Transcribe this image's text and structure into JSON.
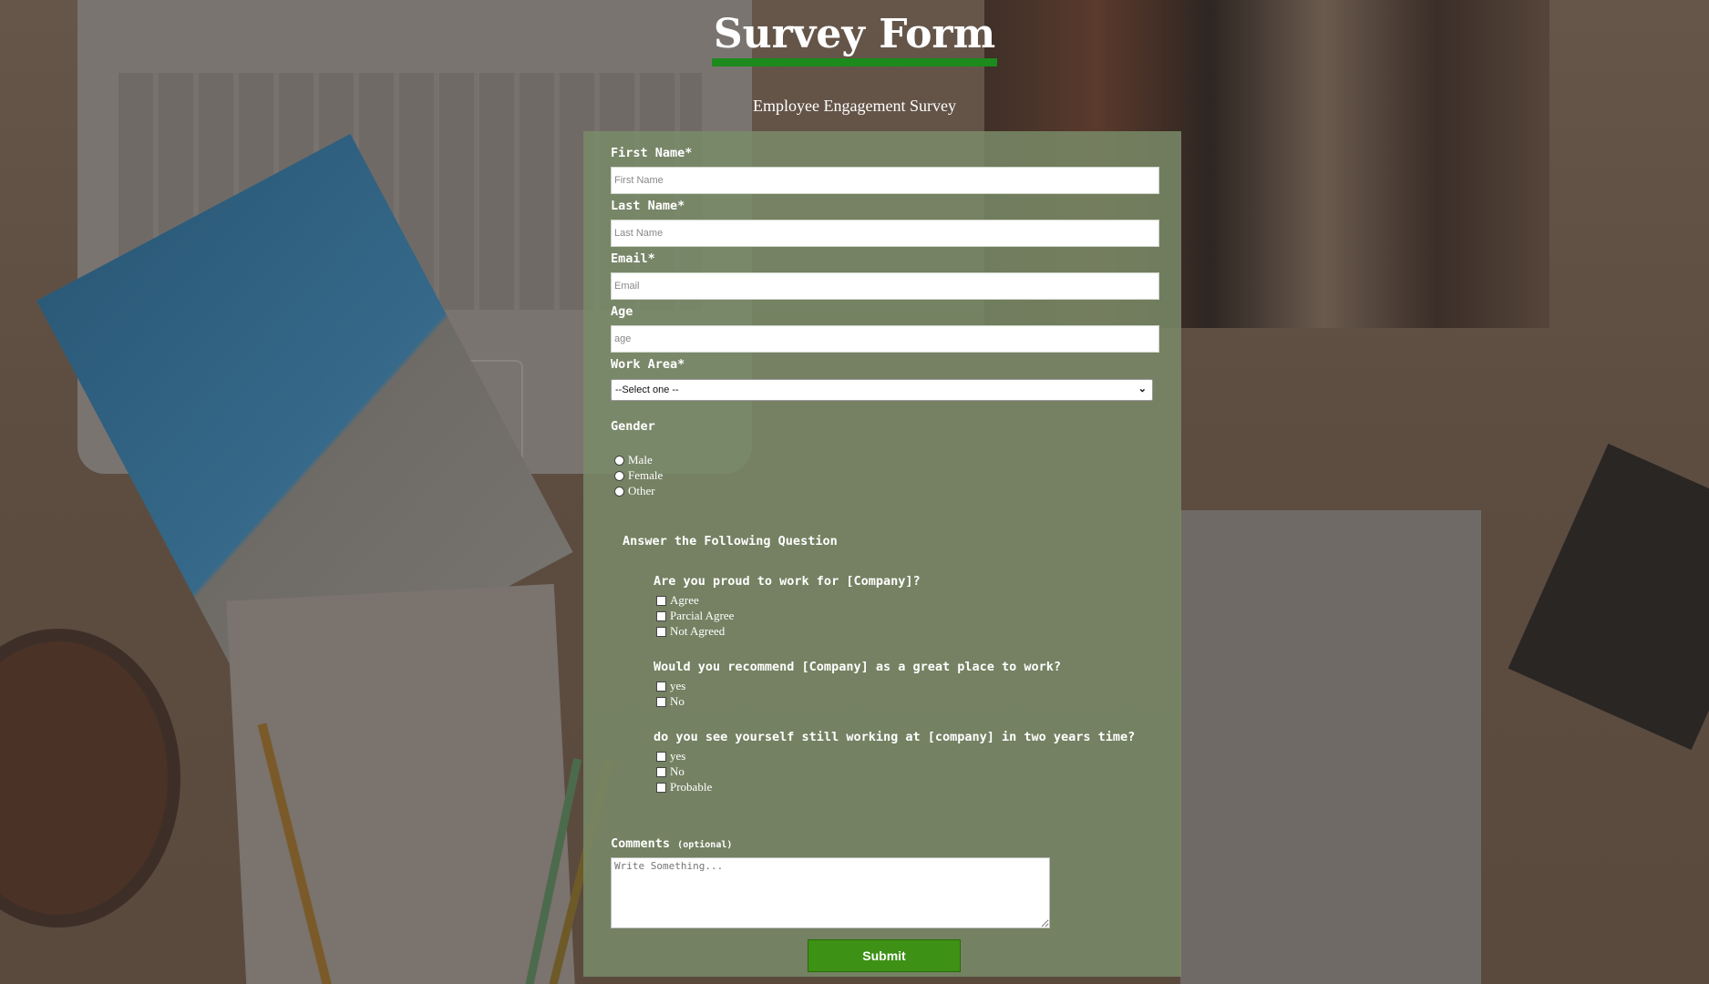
{
  "header": {
    "title": "Survey Form",
    "subtitle": "Employee Engagement Survey"
  },
  "form": {
    "first_name": {
      "label": "First Name*",
      "placeholder": "First Name"
    },
    "last_name": {
      "label": "Last Name*",
      "placeholder": "Last Name"
    },
    "email": {
      "label": "Email*",
      "placeholder": "Email"
    },
    "age": {
      "label": "Age",
      "placeholder": "age"
    },
    "work_area": {
      "label": "Work Area*",
      "selected": "--Select one --"
    },
    "gender": {
      "label": "Gender",
      "options": [
        "Male",
        "Female",
        "Other"
      ]
    },
    "questions_heading": "Answer the Following Question",
    "questions": [
      {
        "text": "Are you proud to work for [Company]?",
        "options": [
          "Agree",
          "Parcial Agree",
          "Not Agreed"
        ]
      },
      {
        "text": "Would you recommend [Company] as a great place to work?",
        "options": [
          "yes",
          "No"
        ]
      },
      {
        "text": "do you see yourself still working at [company] in two years time?",
        "options": [
          "yes",
          "No",
          "Probable"
        ]
      }
    ],
    "comments": {
      "label": "Comments",
      "optional": "(optional)",
      "placeholder": "Write Something..."
    },
    "submit_label": "Submit"
  },
  "colors": {
    "accent_underline": "#1c8a1c",
    "panel": "#798c69",
    "submit_button": "#3d9115"
  }
}
